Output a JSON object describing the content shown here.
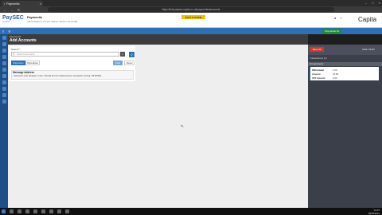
{
  "browser": {
    "tab_title": "Paymentis",
    "url": "https://test.paysec.capita.co.uk/paymentis/accounts",
    "close_glyph": "×"
  },
  "header": {
    "logo": "PaySEC",
    "logo_sub": "Capita",
    "env_title": "Paymentis",
    "env_subtitle": "Client Version 1.0.0.0.0 | Server Version 1.0.0 build",
    "test_badge": "TEST SYSTEM",
    "brand": "Capita"
  },
  "nav": {
    "user_button": "Paymentis 01"
  },
  "page": {
    "breadcrumb": "Paymentis",
    "title": "Add Accounts"
  },
  "search": {
    "label": "Search *",
    "placeholder": "Search Accounts",
    "clear_glyph": "×",
    "lookup_glyph": "⚲"
  },
  "tabs": {
    "payment": "Payments",
    "schedule": "Schedules"
  },
  "actions": {
    "find": "Find",
    "reset": "Reset"
  },
  "message": {
    "heading": "Message Address",
    "text": "• Selected Lucas Vaughan / User / Should be from Failed account recognition sorting / 55.68 BRL"
  },
  "right_panel": {
    "save_label": "Save All",
    "total": "Total: 15.84",
    "tx_label": "Transactions (1)",
    "group_header": "Groupsmenu",
    "summary": [
      {
        "label": "Withdrawal",
        "value": "1.00"
      },
      {
        "label": "Amount",
        "value": "15.84"
      },
      {
        "label": "VAT Amount",
        "value": "3.00"
      }
    ]
  },
  "taskbar": {
    "time": "13:37",
    "date": "08/05/2021"
  }
}
